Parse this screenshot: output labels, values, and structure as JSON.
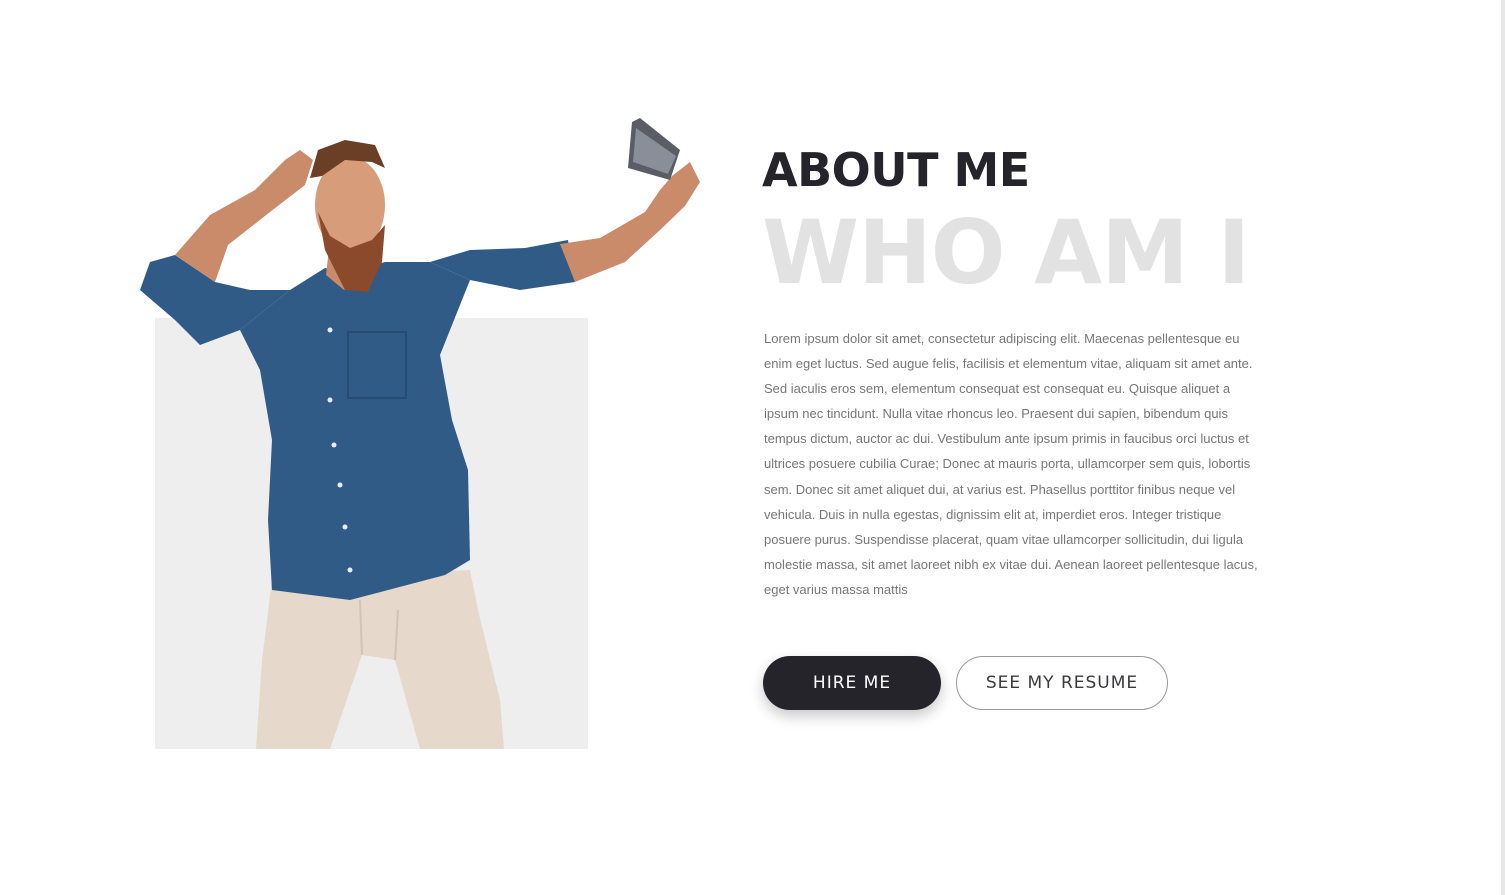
{
  "about": {
    "heading": "ABOUT ME",
    "subheading": "WHO AM I",
    "bio": "Lorem ipsum dolor sit amet, consectetur adipiscing elit. Maecenas pellentesque eu enim eget luctus. Sed augue felis, facilisis et elementum vitae, aliquam sit amet ante. Sed iaculis eros sem, elementum consequat est consequat eu. Quisque aliquet a ipsum nec tincidunt. Nulla vitae rhoncus leo. Praesent dui sapien, bibendum quis tempus dictum, auctor ac dui. Vestibulum ante ipsum primis in faucibus orci luctus et ultrices posuere cubilia Curae; Donec at mauris porta, ullamcorper sem quis, lobortis sem. Donec sit amet aliquet dui, at varius est. Phasellus porttitor finibus neque vel vehicula. Duis in nulla egestas, dignissim elit at, imperdiet eros. Integer tristique posuere purus. Suspendisse placerat, quam vitae ullamcorper sollicitudin, dui ligula molestie massa, sit amet laoreet nibh ex vitae dui. Aenean laoreet pellentesque lacus, eget varius massa mattis"
  },
  "buttons": {
    "hire_label": "HIRE ME",
    "resume_label": "SEE MY RESUME"
  },
  "colors": {
    "heading": "#25242a",
    "subheading": "#e2e2e2",
    "body_text": "#777777",
    "photo_backdrop": "#eeeeee",
    "primary_button": "#25242a",
    "shirt": "#2f5b86",
    "pants": "#e6d9cc"
  },
  "photo": {
    "subject": "bearded man in denim shirt taking a selfie with a phone"
  }
}
